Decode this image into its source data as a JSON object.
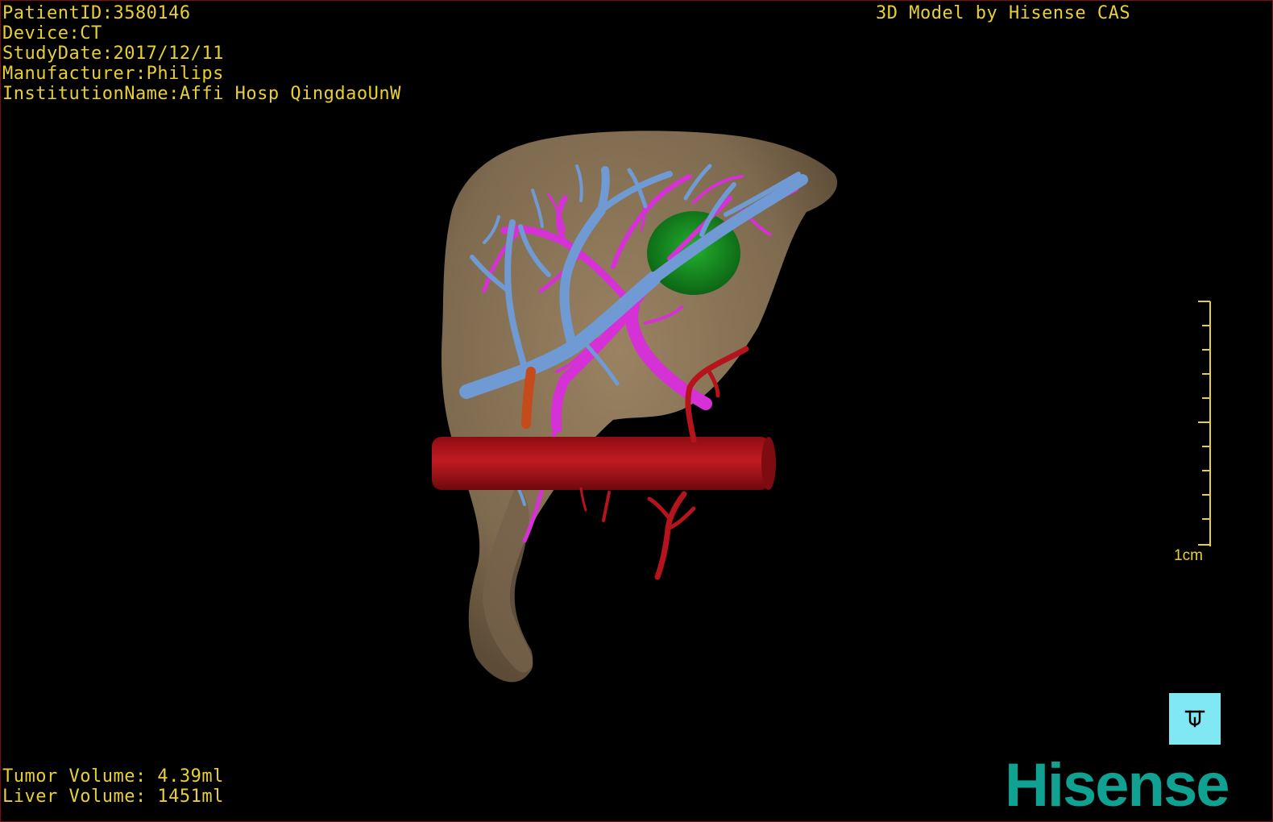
{
  "patient_info": {
    "lines": [
      "PatientID:3580146",
      "Device:CT",
      "StudyDate:2017/12/11",
      "Manufacturer:Philips",
      "InstitutionName:Affi Hosp QingdaoUnW"
    ]
  },
  "title": "3D Model by Hisense CAS",
  "volumes": {
    "tumor": "Tumor Volume: 4.39ml",
    "liver": "Liver Volume: 1451ml"
  },
  "scale_bar": {
    "label": "1cm"
  },
  "brand": "Hisense",
  "colors": {
    "overlay_text": "#e8d033",
    "liver": "#8a7356",
    "portal_vein": "#6f9ad4",
    "hepatic_vein": "#d631d6",
    "tumor": "#148a1e",
    "artery": "#b5141c",
    "orientation_button": "#7fe8f2",
    "brand": "#0fa191"
  },
  "icons": {
    "orientation": "orientation-cube-icon"
  }
}
